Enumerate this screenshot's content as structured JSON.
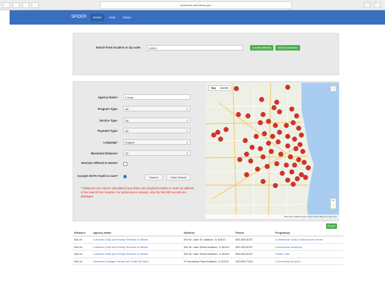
{
  "browser": {
    "url": "spidersuit.dcfs.illinois.gov"
  },
  "nav": {
    "brand": "SPIDER",
    "items": [
      "Home",
      "Help",
      "About"
    ]
  },
  "location_search": {
    "label": "Search from location or zip code:",
    "value": "60601",
    "locate_button": "Locate address",
    "my_location_button": "Add my location"
  },
  "filters": {
    "agency_name": {
      "label": "Agency Name:",
      "value": "Family"
    },
    "program_type": {
      "label": "Program Type:",
      "value": "All"
    },
    "service_type": {
      "label": "Service Type:",
      "value": "All"
    },
    "payment_type": {
      "label": "Payment Type:",
      "value": "All"
    },
    "language": {
      "label": "Language:",
      "value": "English"
    },
    "max_distance": {
      "label": "Maximum Distance:",
      "value": "25"
    },
    "in_home": {
      "label": "Services Offered in Home?"
    },
    "dcfs_youth": {
      "label": "Accepts DCFS Youth in Care?"
    },
    "search_button": "Search",
    "clear_button": "Clear Search",
    "note": "* Distances can only be calculated if you share your physical location or enter an address in the search from location. For performance reasons, only the first 500 records are displayed."
  },
  "map": {
    "tab_map": "Map",
    "tab_satellite": "Satellite",
    "footer": "Map data ©2018 Google   Terms of Use   Report a map error",
    "marker_color": "#d93025"
  },
  "results": {
    "export_label": "Export",
    "headers": [
      "Distance",
      "Agency Name",
      "Address",
      "Phone",
      "Program(s)"
    ],
    "rows": [
      {
        "distance": "N/A mi",
        "agency": "Lutheran Child and Family Services of Illinois",
        "address": "300 W. Lake St. Addison, IL 60101",
        "phone": "800-363-5237",
        "program": "Lutherbrook Child & Adolescent Center"
      },
      {
        "distance": "N/A mi",
        "agency": "Lutheran Child and Family Services of Illinois",
        "address": "300 W. Lake Street Addison, IL 60101",
        "phone": "800-363-5237",
        "program": "Lutherbrook Academy"
      },
      {
        "distance": "N/A mi",
        "agency": "Lutheran Child and Family Services of Illinois",
        "address": "300 W. Lake Street Addison, IL 60101",
        "phone": "800-363-5237",
        "program": "Foster Care"
      },
      {
        "distance": "N/A mi",
        "agency": "Northeast Dupage Family and Youth Services",
        "address": "3 Friendship Plaza Addison, IL 60101",
        "phone": "630-693-7904",
        "program": "Counseling Services"
      }
    ]
  }
}
